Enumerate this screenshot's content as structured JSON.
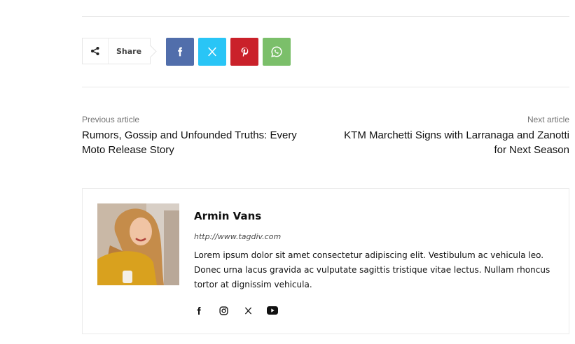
{
  "share": {
    "label": "Share",
    "buttons": [
      {
        "network": "facebook",
        "icon": "facebook-icon",
        "color": "#516eab"
      },
      {
        "network": "x-twitter",
        "icon": "x-icon",
        "color": "#29c5f6"
      },
      {
        "network": "pinterest",
        "icon": "pinterest-icon",
        "color": "#ca212a"
      },
      {
        "network": "whatsapp",
        "icon": "whatsapp-icon",
        "color": "#7bbf6a"
      }
    ]
  },
  "prev_article": {
    "label": "Previous article",
    "title": "Rumors, Gossip and Unfounded Truths: Every Moto Release Story"
  },
  "next_article": {
    "label": "Next article",
    "title": "KTM Marchetti Signs with Larranaga and Zanotti for Next Season"
  },
  "author": {
    "name": "Armin Vans",
    "url": "http://www.tagdiv.com",
    "bio": "Lorem ipsum dolor sit amet consectetur adipiscing elit. Vestibulum ac vehicula leo. Donec urna lacus gravida ac vulputate sagittis tristique vitae lectus. Nullam rhoncus tortor at dignissim vehicula.",
    "social": [
      "facebook-icon",
      "instagram-icon",
      "x-icon",
      "youtube-icon"
    ]
  }
}
